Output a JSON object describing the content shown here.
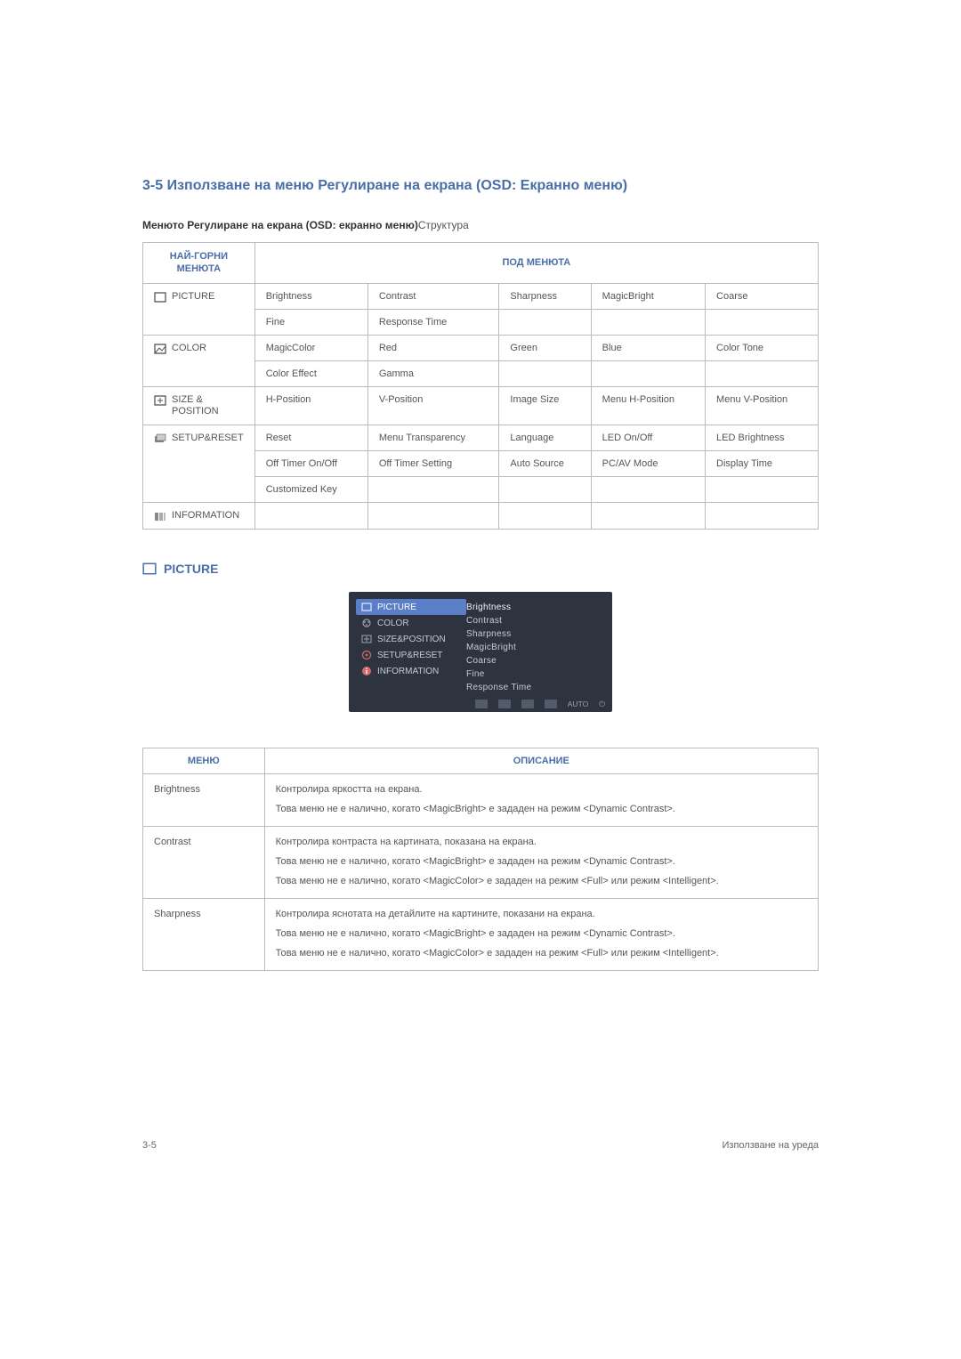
{
  "heading": "3-5   Използване на меню Регулиране на екрана (OSD: Екранно меню)",
  "caption_bold": "Менюто Регулиране на екрана (OSD: екранно меню)",
  "caption_rest": "Структура",
  "table1": {
    "header_left": "НАЙ-ГОРНИ МЕНЮТА",
    "header_right": "ПОД МЕНЮТА",
    "cat_picture": "PICTURE",
    "picture_r1": [
      "Brightness",
      "Contrast",
      "Sharpness",
      "MagicBright",
      "Coarse"
    ],
    "picture_r2": [
      "Fine",
      "Response Time",
      "",
      "",
      ""
    ],
    "cat_color": "COLOR",
    "color_r1": [
      "MagicColor",
      "Red",
      "Green",
      "Blue",
      "Color Tone"
    ],
    "color_r2": [
      "Color Effect",
      "Gamma",
      "",
      "",
      ""
    ],
    "cat_size": "SIZE & POSITION",
    "size_r1": [
      "H-Position",
      "V-Position",
      "Image Size",
      "Menu H-Position",
      "Menu V-Position"
    ],
    "cat_setup": "SETUP&RESET",
    "setup_r1": [
      "Reset",
      "Menu Transparency",
      "Language",
      "LED On/Off",
      "LED Brightness"
    ],
    "setup_r2": [
      "Off Timer On/Off",
      "Off Timer Setting",
      "Auto Source",
      "PC/AV Mode",
      "Display Time"
    ],
    "setup_r3": [
      "Customized Key",
      "",
      "",
      "",
      ""
    ],
    "cat_info": "INFORMATION",
    "info_r1": [
      "",
      "",
      "",
      "",
      ""
    ]
  },
  "picture_heading": "PICTURE",
  "osd": {
    "left": [
      "PICTURE",
      "COLOR",
      "SIZE&POSITION",
      "SETUP&RESET",
      "INFORMATION"
    ],
    "right": [
      "Brightness",
      "Contrast",
      "Sharpness",
      "MagicBright",
      "Coarse",
      "Fine",
      "Response Time"
    ],
    "footer_auto": "AUTO"
  },
  "desc": {
    "header_menu": "МЕНЮ",
    "header_desc": "ОПИСАНИЕ",
    "rows": [
      {
        "menu": "Brightness",
        "paras": [
          "Контролира яркостта на екрана.",
          "Това меню не е налично, когато <MagicBright> е зададен на режим <Dynamic Contrast>."
        ]
      },
      {
        "menu": "Contrast",
        "paras": [
          "Контролира контраста на картината, показана на екрана.",
          "Това меню не е налично, когато <MagicBright> е зададен на режим <Dynamic Contrast>.",
          "Това меню не е налично, когато <MagicColor> е зададен на режим <Full> или режим <Intelligent>."
        ]
      },
      {
        "menu": "Sharpness",
        "paras": [
          "Контролира яснотата на детайлите на картините, показани на екрана.",
          "Това меню не е налично, когато <MagicBright> е зададен на режим <Dynamic Contrast>.",
          "Това меню не е налично, когато <MagicColor> е зададен на режим <Full> или режим <Intelligent>."
        ]
      }
    ]
  },
  "footer_left": "3-5",
  "footer_right": "Използване на уреда"
}
